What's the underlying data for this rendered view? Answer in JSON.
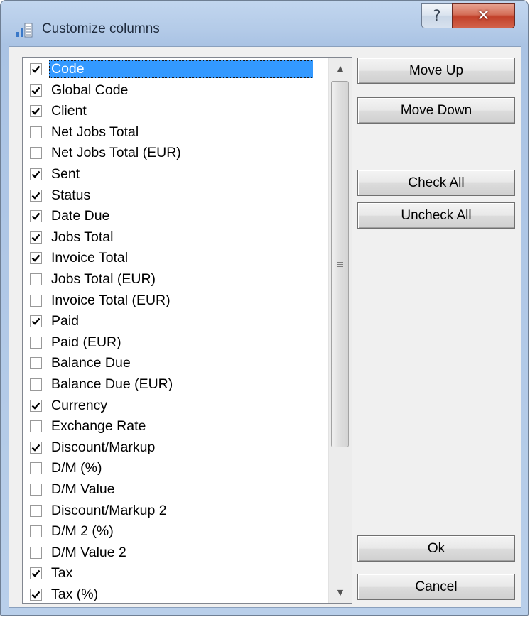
{
  "window": {
    "title": "Customize columns",
    "help_glyph": "?",
    "close_glyph": "✕"
  },
  "columns": [
    {
      "label": "Code",
      "checked": true,
      "selected": true
    },
    {
      "label": "Global Code",
      "checked": true
    },
    {
      "label": "Client",
      "checked": true
    },
    {
      "label": "Net Jobs Total",
      "checked": false
    },
    {
      "label": "Net Jobs Total (EUR)",
      "checked": false
    },
    {
      "label": "Sent",
      "checked": true
    },
    {
      "label": "Status",
      "checked": true
    },
    {
      "label": "Date Due",
      "checked": true
    },
    {
      "label": "Jobs Total",
      "checked": true
    },
    {
      "label": "Invoice Total",
      "checked": true
    },
    {
      "label": "Jobs Total (EUR)",
      "checked": false
    },
    {
      "label": "Invoice Total (EUR)",
      "checked": false
    },
    {
      "label": "Paid",
      "checked": true
    },
    {
      "label": "Paid (EUR)",
      "checked": false
    },
    {
      "label": "Balance Due",
      "checked": false
    },
    {
      "label": "Balance Due (EUR)",
      "checked": false
    },
    {
      "label": "Currency",
      "checked": true
    },
    {
      "label": "Exchange Rate",
      "checked": false
    },
    {
      "label": "Discount/Markup",
      "checked": true
    },
    {
      "label": "D/M (%)",
      "checked": false
    },
    {
      "label": "D/M Value",
      "checked": false
    },
    {
      "label": "Discount/Markup 2",
      "checked": false
    },
    {
      "label": "D/M 2 (%)",
      "checked": false
    },
    {
      "label": "D/M Value 2",
      "checked": false
    },
    {
      "label": "Tax",
      "checked": true
    },
    {
      "label": "Tax (%)",
      "checked": true
    }
  ],
  "buttons": {
    "move_up": "Move Up",
    "move_down": "Move Down",
    "check_all": "Check All",
    "uncheck_all": "Uncheck All",
    "ok": "Ok",
    "cancel": "Cancel"
  },
  "icons": {
    "title": "columns-icon",
    "help": "help-icon",
    "close": "close-icon",
    "scroll_up": "scroll-up-arrow-icon",
    "scroll_down": "scroll-down-arrow-icon",
    "grip": "scroll-grip-icon"
  },
  "colors": {
    "selection": "#3399ff",
    "close_button": "#c2412a",
    "title_bar": "#b4cbe8"
  }
}
